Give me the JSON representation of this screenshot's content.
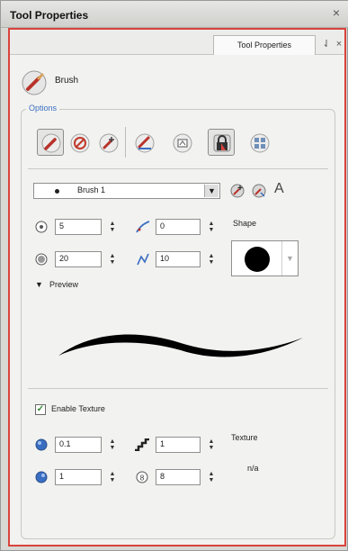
{
  "window": {
    "title": "Tool Properties"
  },
  "tab": {
    "label": "Tool Properties"
  },
  "tool": {
    "name": "Brush"
  },
  "options": {
    "legend": "Options",
    "brush_preset": "Brush 1"
  },
  "size": {
    "min": "5",
    "max": "20"
  },
  "smoothing": {
    "value": "0"
  },
  "contour": {
    "value": "10"
  },
  "shape": {
    "label": "Shape"
  },
  "preview": {
    "label": "Preview"
  },
  "texture": {
    "enable_label": "Enable Texture",
    "enabled": true,
    "opacity": "0.1",
    "scale": "1",
    "density": "1",
    "seed": "8",
    "label": "Texture",
    "value": "n/a"
  },
  "colors": {
    "panel_border": "#d9433c",
    "accent": "#3a6ec2"
  }
}
